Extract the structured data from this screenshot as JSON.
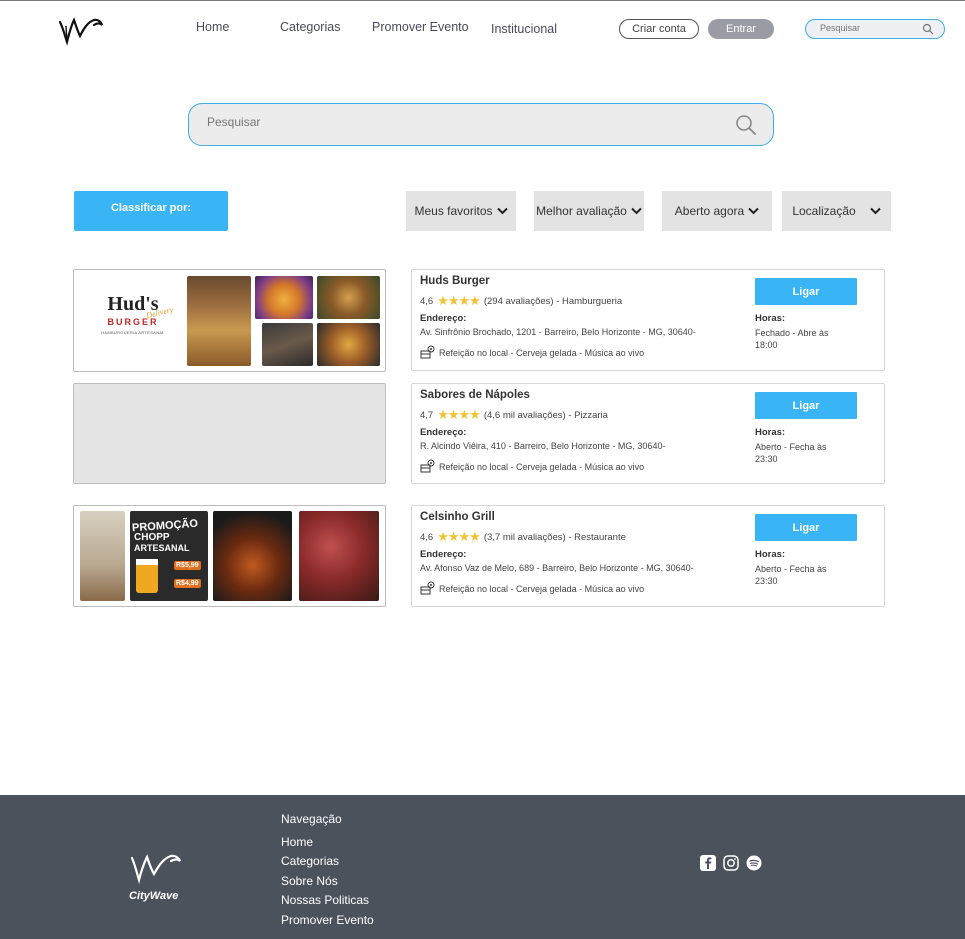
{
  "header": {
    "nav": [
      "Home",
      "Categorias",
      "Promover Evento",
      "Institucional"
    ],
    "criar_conta": "Criar conta",
    "entrar": "Entrar",
    "search_placeholder": "Pesquisar"
  },
  "main_search": {
    "placeholder": "Pesquisar"
  },
  "sort": {
    "label": "Classificar por:",
    "filters": [
      "Meus favoritos",
      "Melhor avaliação",
      "Aberto agora",
      "Localização"
    ]
  },
  "restaurants": [
    {
      "name": "Huds Burger",
      "rating": "4,6",
      "reviews": "(294 avaliações) - Hamburgueria",
      "address_label": "Endereço:",
      "address": "Av. Sinfrônio Brochado, 1201 - Barreiro, Belo Horizonte - MG, 30640-",
      "features": "Refeição no local  -  Cerveja gelada  -  Música ao vivo",
      "call": "Ligar",
      "hours_label": "Horas:",
      "hours": "Fechado - Abre às 18:00",
      "logo_text": "Hud's",
      "logo_sub": "BURGER",
      "logo_script": "Delivery",
      "logo_tag": "HAMBURGUERIA ARTESANAL"
    },
    {
      "name": "Sabores de Nápoles",
      "rating": "4,7",
      "reviews": "(4,6 mil  avaliações) - Pizzaria",
      "address_label": "Endereço:",
      "address": "R. Alcindo Viêira, 410 - Barreiro, Belo Horizonte - MG, 30640-",
      "features": "Refeição no local  -  Cerveja gelada  -  Música ao vivo",
      "call": "Ligar",
      "hours_label": "Horas:",
      "hours": "Aberto - Fecha às 23:30"
    },
    {
      "name": "Celsinho Grill",
      "rating": "4,6",
      "reviews": "(3,7 mil  avaliações) - Restaurante",
      "address_label": "Endereço:",
      "address": "Av. Afonso Vaz de Melo, 689 - Barreiro, Belo Horizonte - MG, 30640-",
      "features": "Refeição no local  -  Cerveja gelada  -  Música ao vivo",
      "call": "Ligar",
      "hours_label": "Horas:",
      "hours": "Aberto - Fecha às 23:30",
      "promo_lines": [
        "PROMOÇÃO",
        "CHOPP",
        "ARTESANAL"
      ],
      "promo_prices": [
        "R$5,99",
        "R$4,99"
      ]
    }
  ],
  "footer": {
    "brand": "CityWave",
    "nav_title": "Navegação",
    "links": [
      "Home",
      "Categorias",
      "Sobre Nós",
      "Nossas Politicas",
      "Promover Evento"
    ],
    "social_icons": [
      "facebook-icon",
      "instagram-icon",
      "spotify-icon"
    ]
  },
  "colors": {
    "accent": "#39b5f5",
    "filter_bg": "#e3e3e3",
    "footer_bg": "#4b525c",
    "stars": "#f2c233"
  }
}
